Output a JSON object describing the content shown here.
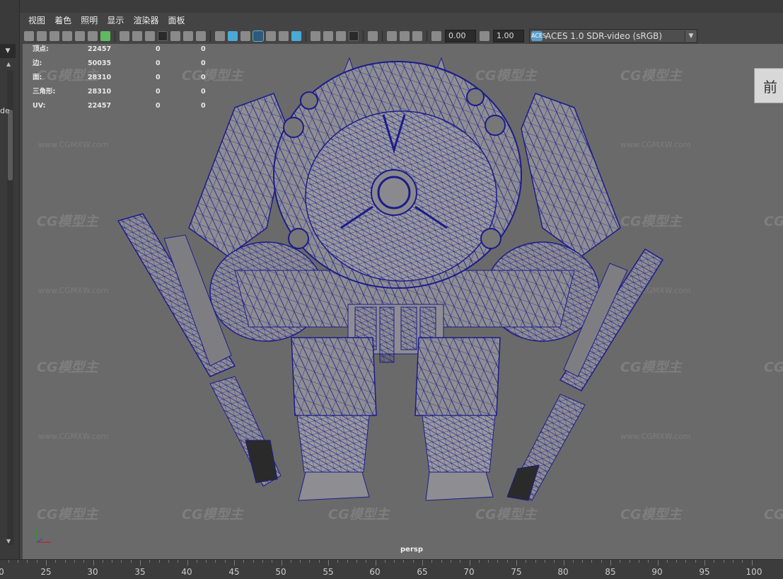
{
  "menu": [
    "视图",
    "着色",
    "照明",
    "显示",
    "渲染器",
    "面板"
  ],
  "toolbar": {
    "value1": "0.00",
    "value2": "1.00",
    "color_space_icon": "ACES",
    "color_space": "ACES 1.0 SDR-video (sRGB)"
  },
  "hud": {
    "rows": [
      {
        "label": "顶点:",
        "v1": "22457",
        "v2": "0",
        "v3": "0"
      },
      {
        "label": "边:",
        "v1": "50035",
        "v2": "0",
        "v3": "0"
      },
      {
        "label": "面:",
        "v1": "28310",
        "v2": "0",
        "v3": "0"
      },
      {
        "label": "三角形:",
        "v1": "28310",
        "v2": "0",
        "v3": "0"
      },
      {
        "label": "UV:",
        "v1": "22457",
        "v2": "0",
        "v3": "0"
      }
    ]
  },
  "viewcube_label": "前",
  "camera_label": "persp",
  "watermark": {
    "logo": "CG模型主",
    "url": "www.CGMXW.com"
  },
  "timeline": {
    "labels": [
      "0",
      "25",
      "30",
      "35",
      "40",
      "45",
      "50",
      "55",
      "60",
      "65",
      "70",
      "75",
      "80",
      "85",
      "90",
      "95",
      "100"
    ]
  },
  "left_panel": {
    "clipped_text": "de"
  },
  "colors": {
    "viewport_bg": "#6a6a6a",
    "wireframe": "#1c1c8c",
    "mesh_fill": "#8e8e92"
  }
}
